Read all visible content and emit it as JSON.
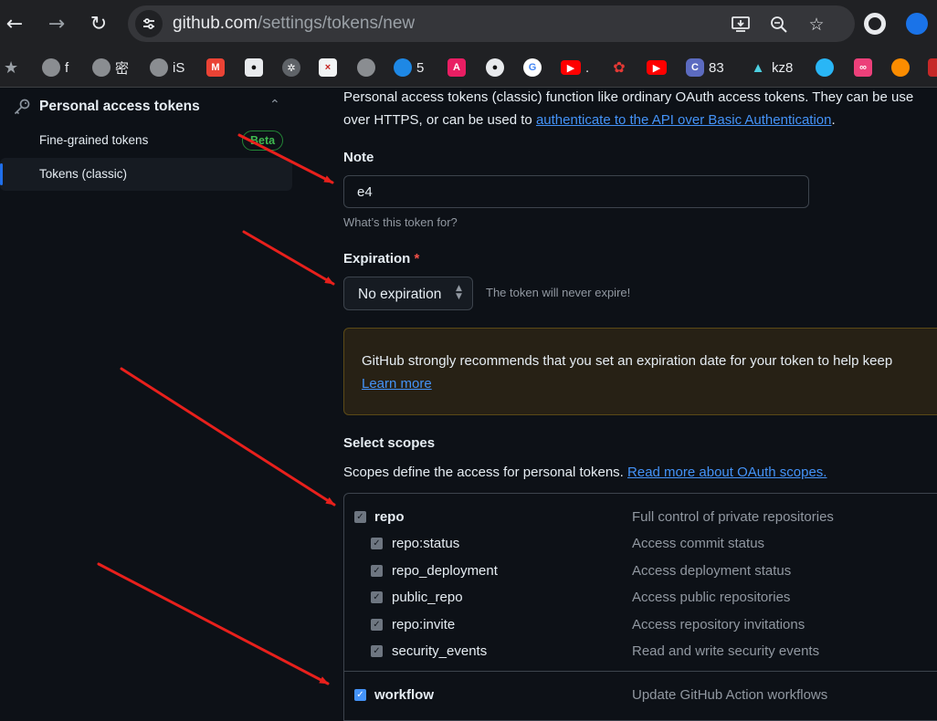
{
  "browser": {
    "url_host": "github.com",
    "url_path": "/settings/tokens/new",
    "bookmarks": [
      {
        "icon": "globe-icon",
        "label": "f"
      },
      {
        "icon": "globe-icon",
        "label": "密"
      },
      {
        "icon": "globe-icon",
        "label": "iS"
      },
      {
        "icon": "gmail-icon",
        "label": ""
      },
      {
        "icon": "panda-icon",
        "label": ""
      },
      {
        "icon": "openai-icon",
        "label": ""
      },
      {
        "icon": "app-icon",
        "label": ""
      },
      {
        "icon": "globe-icon",
        "label": ""
      },
      {
        "icon": "cloud-icon",
        "label": "5"
      },
      {
        "icon": "translate-icon",
        "label": ""
      },
      {
        "icon": "github-icon",
        "label": ""
      },
      {
        "icon": "google-icon",
        "label": ""
      },
      {
        "icon": "youtube-icon",
        "label": "."
      },
      {
        "icon": "red-logo-icon",
        "label": ""
      },
      {
        "icon": "youtube-icon",
        "label": ""
      },
      {
        "icon": "app-icon",
        "label": "83"
      },
      {
        "icon": "mountain-icon",
        "label": "kz8"
      },
      {
        "icon": "app-icon",
        "label": ""
      },
      {
        "icon": "app-icon",
        "label": ""
      },
      {
        "icon": "circle-icon",
        "label": ""
      },
      {
        "icon": "app-icon",
        "label": ""
      }
    ]
  },
  "sidebar": {
    "section_title": "Personal access tokens",
    "items": [
      {
        "label": "Fine-grained tokens",
        "badge": "Beta"
      },
      {
        "label": "Tokens (classic)"
      }
    ]
  },
  "main": {
    "intro_line1": "Personal access tokens (classic) function like ordinary OAuth access tokens. They can be use",
    "intro_line2_prefix": "over HTTPS, or can be used to ",
    "intro_link": "authenticate to the API over Basic Authentication",
    "intro_line2_suffix": ".",
    "note_label": "Note",
    "note_value": "e4",
    "note_hint": "What’s this token for?",
    "expiration_label": "Expiration",
    "expiration_required": "*",
    "expiration_value": "No expiration",
    "expiration_hint": "The token will never expire!",
    "warning_text": "GitHub strongly recommends that you set an expiration date for your token to help keep",
    "warning_link": "Learn more",
    "scopes_title": "Select scopes",
    "scopes_desc_prefix": "Scopes define the access for personal tokens. ",
    "scopes_link": "Read more about OAuth scopes.",
    "scopes": [
      {
        "name": "repo",
        "desc": "Full control of private repositories",
        "parent": true,
        "checked": true
      },
      {
        "name": "repo:status",
        "desc": "Access commit status",
        "parent": false,
        "checked": true
      },
      {
        "name": "repo_deployment",
        "desc": "Access deployment status",
        "parent": false,
        "checked": true
      },
      {
        "name": "public_repo",
        "desc": "Access public repositories",
        "parent": false,
        "checked": true
      },
      {
        "name": "repo:invite",
        "desc": "Access repository invitations",
        "parent": false,
        "checked": true
      },
      {
        "name": "security_events",
        "desc": "Read and write security events",
        "parent": false,
        "checked": true
      },
      {
        "name": "workflow",
        "desc": "Update GitHub Action workflows",
        "parent": true,
        "checked": true
      }
    ]
  },
  "colors": {
    "accent": "#4493f8",
    "annotation_arrow": "#e8201c"
  }
}
